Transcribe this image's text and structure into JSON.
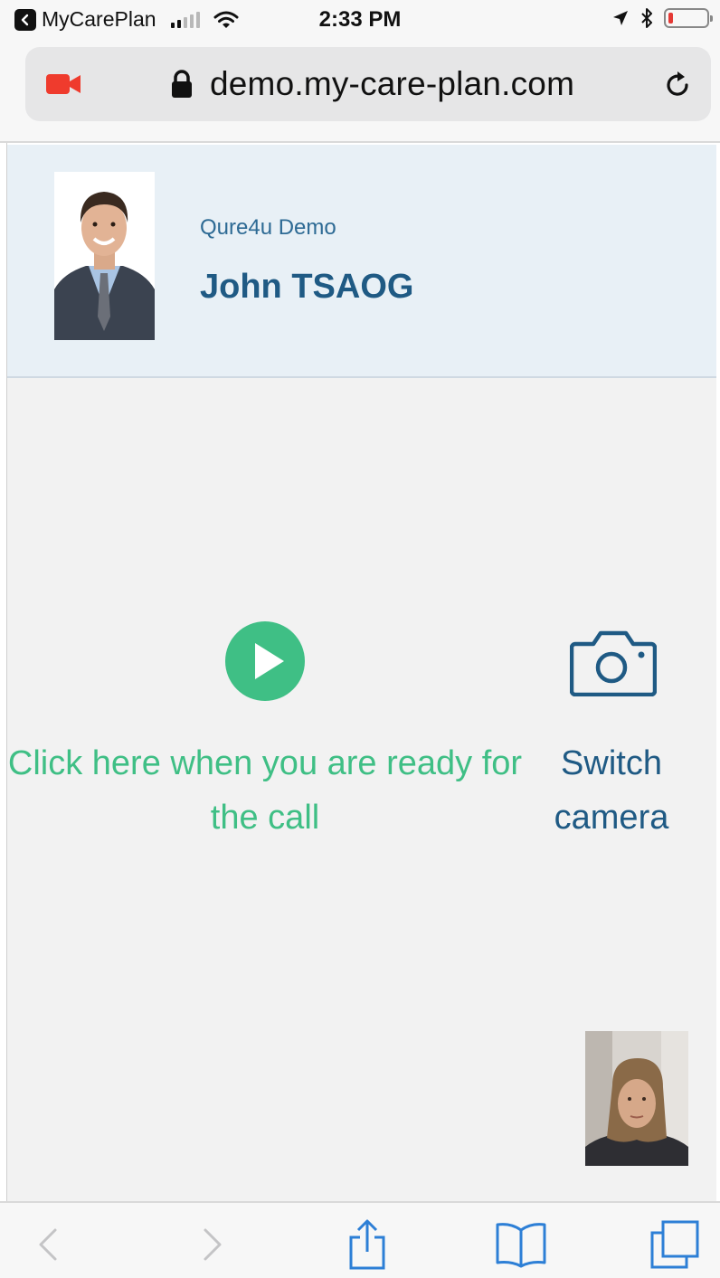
{
  "status_bar": {
    "back_app": "MyCarePlan",
    "time": "2:33 PM",
    "battery_level": 0.12
  },
  "browser": {
    "url": "demo.my-care-plan.com",
    "icons": [
      "video-camera-icon",
      "lock-icon",
      "reload-icon"
    ]
  },
  "header": {
    "organization": "Qure4u Demo",
    "patient_name": "John TSAOG"
  },
  "call": {
    "ready_label": "Click here when you are ready for the call",
    "switch_label": "Switch camera",
    "accent_green": "#3fbf85",
    "accent_blue": "#1f5a84"
  },
  "toolbar": {
    "icons": [
      "back-icon",
      "forward-icon",
      "share-icon",
      "bookmarks-icon",
      "tabs-icon"
    ]
  }
}
